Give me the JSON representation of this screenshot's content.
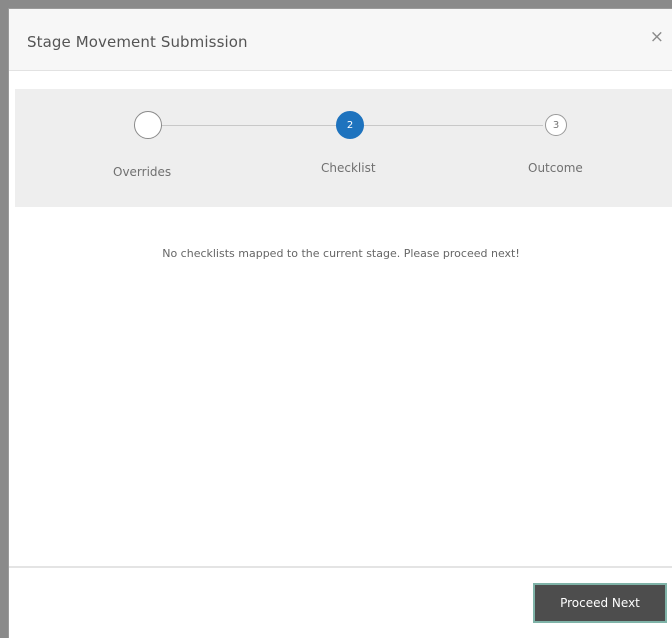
{
  "dialog": {
    "title": "Stage Movement Submission",
    "close_label": "×"
  },
  "stepper": {
    "steps": [
      {
        "label": "Overrides",
        "number": "",
        "state": "completed"
      },
      {
        "label": "Checklist",
        "number": "2",
        "state": "active"
      },
      {
        "label": "Outcome",
        "number": "3",
        "state": "pending"
      }
    ]
  },
  "content": {
    "message": "No checklists mapped to the current stage. Please proceed next!"
  },
  "footer": {
    "proceed_label": "Proceed Next"
  },
  "colors": {
    "active_step": "#1e73be",
    "button_bg": "#4d4d4d",
    "button_border": "#7fb3a8"
  },
  "icons": {
    "close": "close-icon"
  }
}
